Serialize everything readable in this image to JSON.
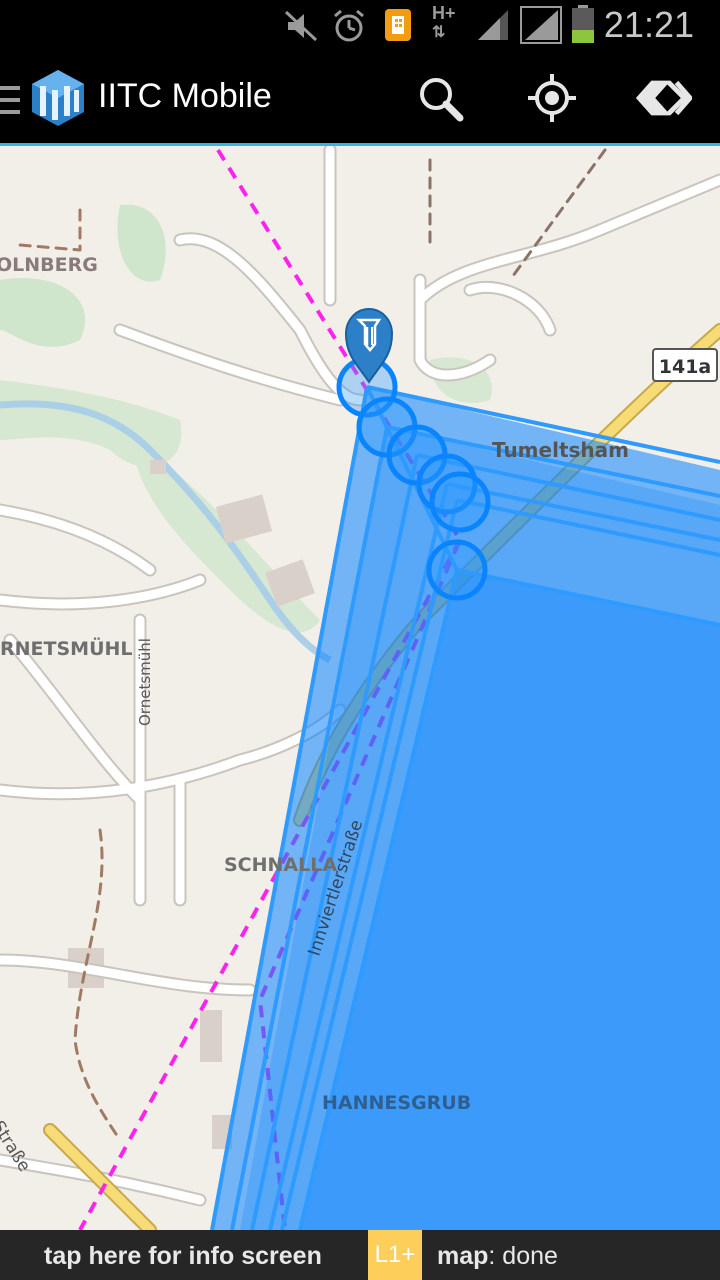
{
  "status_bar": {
    "time": "21:21",
    "icons": [
      "mute-icon",
      "alarm-icon",
      "notification-app-icon",
      "hplus-data-icon",
      "signal-icon",
      "signal-icon",
      "battery-icon"
    ],
    "network_type": "H+"
  },
  "action_bar": {
    "title": "IITC Mobile",
    "menu_icon": "hamburger-icon",
    "logo_icon": "iitc-logo-icon",
    "buttons": [
      {
        "name": "search-button",
        "icon": "search-icon"
      },
      {
        "name": "locate-button",
        "icon": "crosshair-icon"
      },
      {
        "name": "layers-button",
        "icon": "layers-icon"
      }
    ]
  },
  "map": {
    "labels": {
      "olnberg": "OLNBERG",
      "tumeltsham": "Tumeltsham",
      "ornetsmuehl": "RNETSMÜHL",
      "ornetsmuehl_street": "Ornetsmühl",
      "innviertler": "Innviertlerstraße",
      "schnalla": "SCHNALLA",
      "johannesgrub": "HANNESGRUB",
      "strasse_left": "ler Straße"
    },
    "road_shield": "141a",
    "portal_marker_icon": "ingress-portal-marker-icon",
    "field_color": "#0a84ff",
    "link_color": "#2f9aff",
    "dashed_line_color": "#ff22ee"
  },
  "bottom_bar": {
    "info_text": "tap here for info screen",
    "level_badge": "L1+",
    "map_status_label": "map",
    "map_status_value": ": done",
    "level_badge_color": "#fece5a"
  }
}
